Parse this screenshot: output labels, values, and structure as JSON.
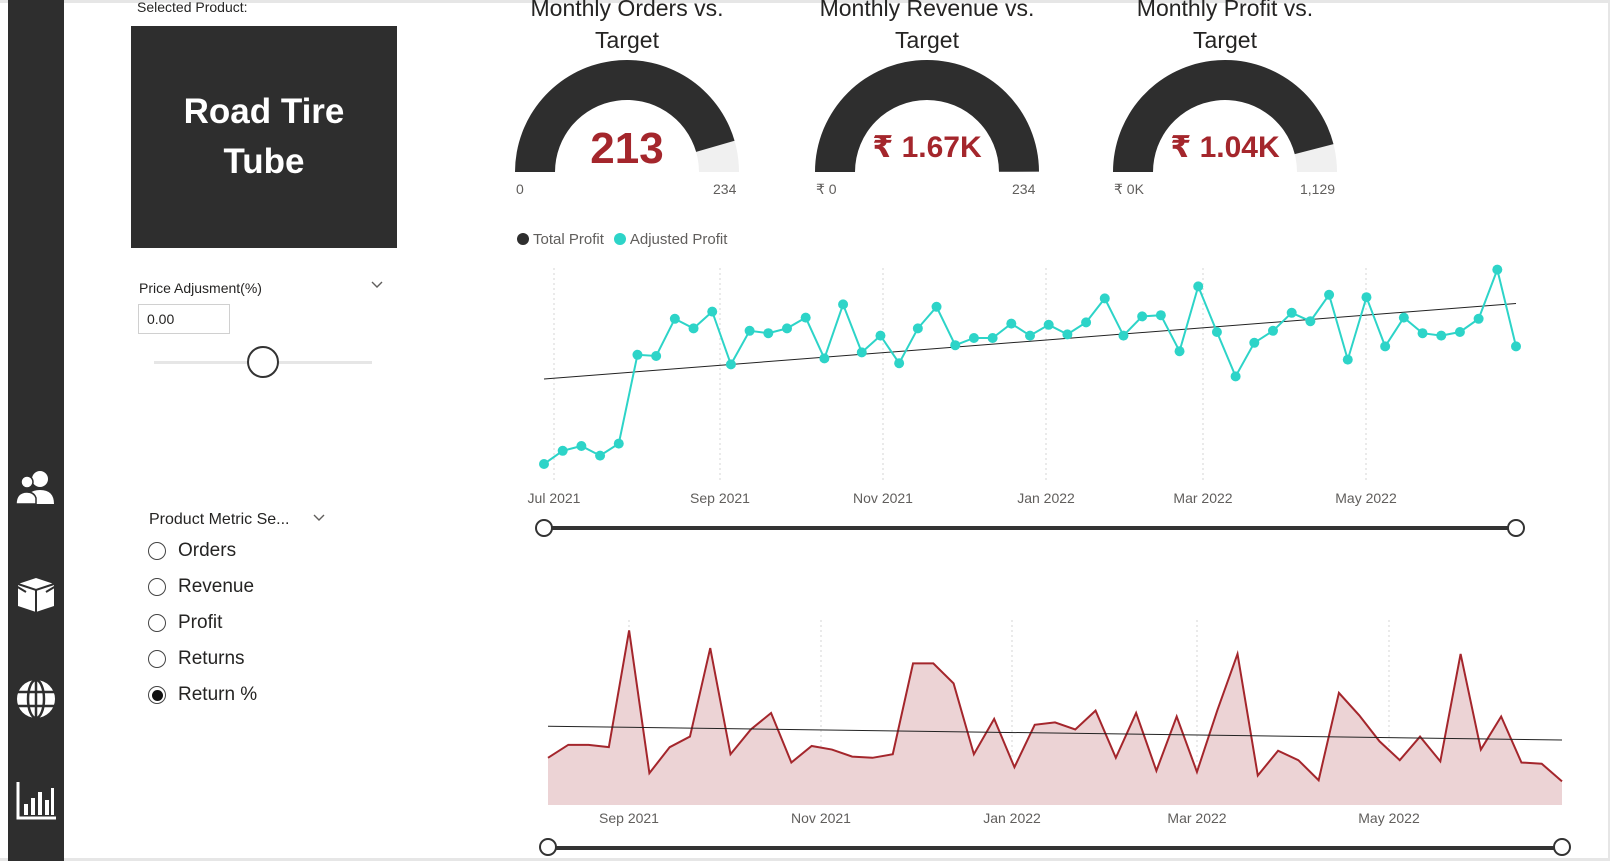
{
  "sidebar": {
    "items": [
      {
        "icon": "users-icon"
      },
      {
        "icon": "box-icon"
      },
      {
        "icon": "globe-icon"
      },
      {
        "icon": "bar-chart-icon"
      }
    ]
  },
  "filters": {
    "selected_product_label": "Selected Product:",
    "selected_product": "Road Tire Tube",
    "price_adjustment_label": "Price Adjusment(%)",
    "price_adjustment_value": "0.00",
    "price_slider_fraction": 0.5,
    "metric_selector_label": "Product Metric Se...",
    "metric_options": [
      "Orders",
      "Revenue",
      "Profit",
      "Returns",
      "Return %"
    ],
    "metric_selected": "Return %"
  },
  "gauges": [
    {
      "title_line1": "Monthly Orders vs.",
      "title_line2": "Target",
      "value": "213",
      "min": "0",
      "max": "234",
      "fraction": 0.91
    },
    {
      "title_line1": "Monthly Revenue vs.",
      "title_line2": "Target",
      "value": "₹ 1.67K",
      "min": "₹ 0",
      "max": "234",
      "fraction": 1.0
    },
    {
      "title_line1": "Monthly Profit vs.",
      "title_line2": "Target",
      "value": "₹ 1.04K",
      "min": "₹ 0K",
      "max": "1,129",
      "fraction": 0.92
    }
  ],
  "colors": {
    "dark": "#2e2e2e",
    "accent_red": "#a4262c",
    "teal": "#2dd4c8",
    "area_fill": "#ecd3d5",
    "gauge_bg": "#f0f0f0"
  },
  "chart_data": [
    {
      "type": "line",
      "series": [
        {
          "name": "Total Profit",
          "values": []
        },
        {
          "name": "Adjusted Profit",
          "values": [
            5,
            16,
            20,
            12,
            22,
            96,
            95,
            126,
            118,
            132,
            88,
            116,
            114,
            118,
            127,
            93,
            138,
            98,
            112,
            89,
            118,
            136,
            104,
            110,
            110,
            122,
            112,
            121,
            113,
            123,
            143,
            112,
            128,
            129,
            99,
            153,
            115,
            78,
            106,
            116,
            131,
            124,
            146,
            92,
            144,
            103,
            127,
            114,
            112,
            115,
            126,
            167,
            103
          ]
        }
      ],
      "x_ticks": [
        "Jul 2021",
        "Sep 2021",
        "Nov 2021",
        "Jan 2022",
        "Mar 2022",
        "May 2022"
      ],
      "legend_position": "top-left",
      "trendline": true
    },
    {
      "type": "area",
      "series": [
        {
          "name": "",
          "values": [
            40,
            51,
            51,
            49,
            148,
            27,
            49,
            58,
            133,
            43,
            64,
            78,
            36,
            50,
            47,
            41,
            40,
            43,
            120,
            120,
            103,
            43,
            73,
            32,
            68,
            70,
            64,
            80,
            40,
            78,
            29,
            75,
            28,
            80,
            128,
            25,
            46,
            38,
            21,
            95,
            76,
            54,
            38,
            58,
            37,
            128,
            47,
            75,
            36,
            35,
            20
          ]
        }
      ],
      "x_ticks": [
        "Sep 2021",
        "Nov 2021",
        "Jan 2022",
        "Mar 2022",
        "May 2022"
      ],
      "trendline": true
    }
  ]
}
